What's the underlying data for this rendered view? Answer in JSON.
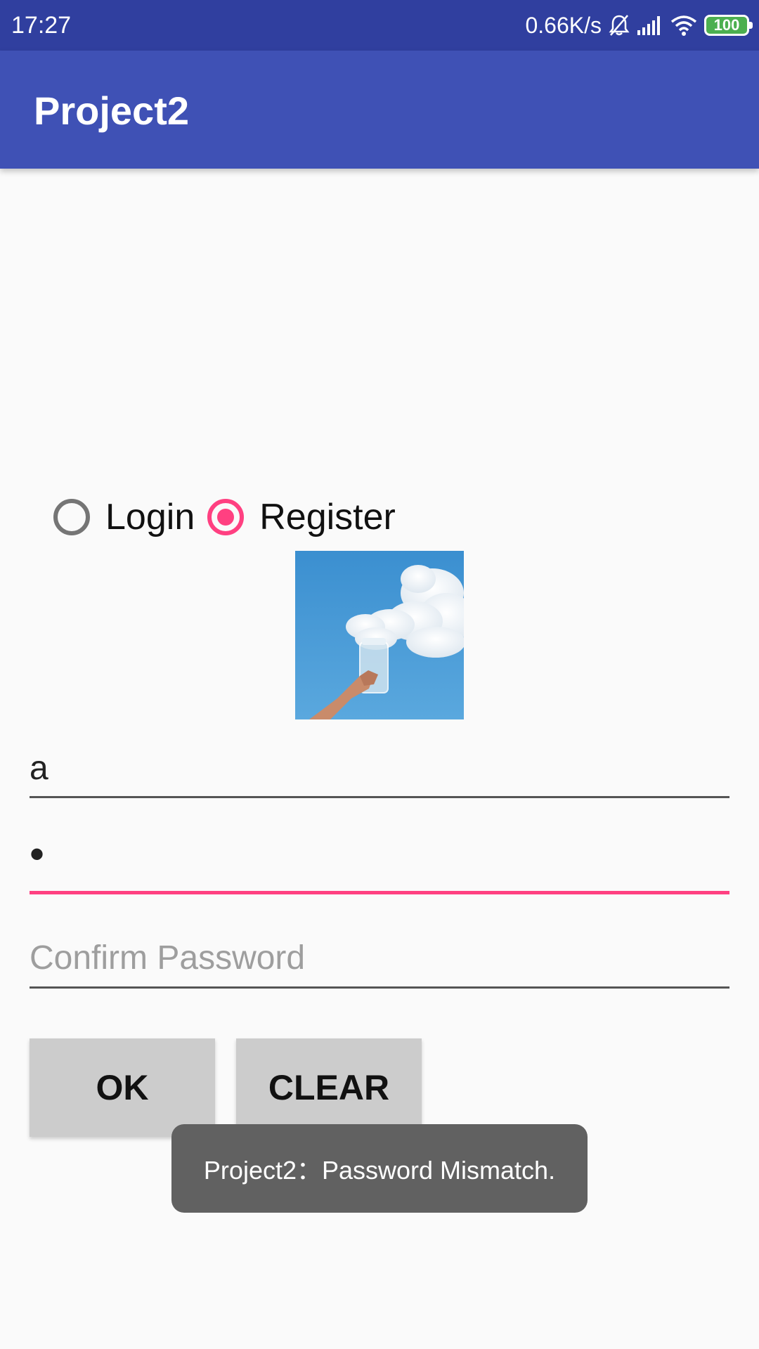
{
  "status_bar": {
    "time": "17:27",
    "network_speed": "0.66K/s",
    "icons": [
      "notifications-off-icon",
      "signal-icon",
      "wifi-icon",
      "battery-icon"
    ],
    "battery_level": "100"
  },
  "app_bar": {
    "title": "Project2",
    "color": "#3f51b5"
  },
  "mode": {
    "options": [
      {
        "label": "Login",
        "checked": false
      },
      {
        "label": "Register",
        "checked": true
      }
    ],
    "accent_color": "#ff4081"
  },
  "image": {
    "icon": "cloud-in-jar-photo"
  },
  "form": {
    "username": {
      "value": "a",
      "placeholder": ""
    },
    "password": {
      "value": "•",
      "placeholder": "",
      "focused": true
    },
    "confirm_password": {
      "value": "",
      "placeholder": "Confirm Password"
    }
  },
  "buttons": {
    "ok_label": "OK",
    "clear_label": "CLEAR"
  },
  "toast": {
    "message": "Project2：Password Mismatch."
  }
}
